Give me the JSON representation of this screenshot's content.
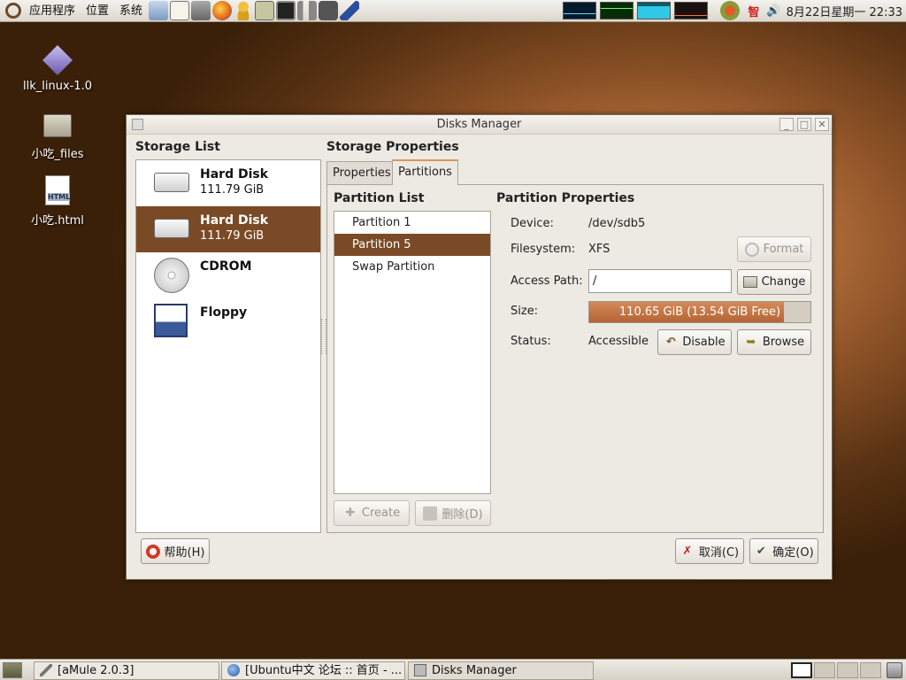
{
  "top_panel": {
    "menus": [
      "应用程序",
      "位置",
      "系统"
    ],
    "clock": "8月22日星期一 22:33",
    "tray_icon": "智"
  },
  "desktop_icons": [
    {
      "label": "llk_linux-1.0"
    },
    {
      "label": "小吃_files"
    },
    {
      "label": "小吃.html"
    }
  ],
  "window": {
    "title": "Disks Manager",
    "storage_list_heading": "Storage List",
    "storage_items": [
      {
        "name": "Hard Disk",
        "size": "111.79 GiB",
        "icon": "harddisk-icon",
        "selected": false
      },
      {
        "name": "Hard Disk",
        "size": "111.79 GiB",
        "icon": "harddisk-icon",
        "selected": true
      },
      {
        "name": "CDROM",
        "size": "",
        "icon": "cdrom-icon",
        "selected": false
      },
      {
        "name": "Floppy",
        "size": "",
        "icon": "floppy-icon",
        "selected": false
      }
    ],
    "storage_props_heading": "Storage Properties",
    "tabs": [
      "Properties",
      "Partitions"
    ],
    "active_tab": "Partitions",
    "partition_list_heading": "Partition List",
    "partitions": [
      "Partition 1",
      "Partition 5",
      "Swap Partition"
    ],
    "selected_partition": "Partition 5",
    "partition_props_heading": "Partition Properties",
    "device_label": "Device:",
    "device_value": "/dev/sdb5",
    "fs_label": "Filesystem:",
    "fs_value": "XFS",
    "format_button": "Format",
    "access_label": "Access Path:",
    "access_value": "/",
    "change_button": "Change",
    "size_label": "Size:",
    "size_text": "110.65 GiB (13.54 GiB Free)",
    "size_used_fraction": 0.878,
    "status_label": "Status:",
    "status_value": "Accessible",
    "disable_button": "Disable",
    "browse_button": "Browse",
    "create_button": "Create",
    "delete_button": "删除(D)",
    "help_button": "帮助(H)",
    "cancel_button": "取消(C)",
    "ok_button": "确定(O)"
  },
  "taskbar": {
    "tasks": [
      "[aMule 2.0.3]",
      "[Ubuntu中文 论坛 :: 首页 - ...",
      "Disks Manager"
    ]
  },
  "colors": {
    "selection": "#7a4a26",
    "size_fill": "#b46434"
  }
}
